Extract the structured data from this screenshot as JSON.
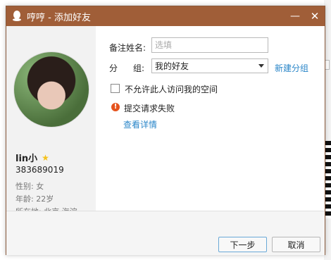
{
  "window": {
    "title": "哼哼 - 添加好友",
    "minimize_glyph": "—",
    "close_glyph": "✕"
  },
  "profile": {
    "name": "lin小",
    "qq_number": "383689019",
    "gender": "性别: 女",
    "age": "年龄: 22岁",
    "location": "所在地: 北京  海淀"
  },
  "form": {
    "remark_label": "备注姓名:",
    "remark_placeholder": "选填",
    "group_label_a": "分",
    "group_label_b": "组:",
    "group_value": "我的好友",
    "new_group_link": "新建分组",
    "checkbox_label": "不允许此人访问我的空间"
  },
  "status": {
    "error_text": "提交请求失败",
    "details_link": "查看详情"
  },
  "buttons": {
    "next": "下一步",
    "cancel": "取消"
  },
  "colors": {
    "titlebar": "#a05e38",
    "link": "#2a86c8",
    "error": "#e5531d"
  }
}
